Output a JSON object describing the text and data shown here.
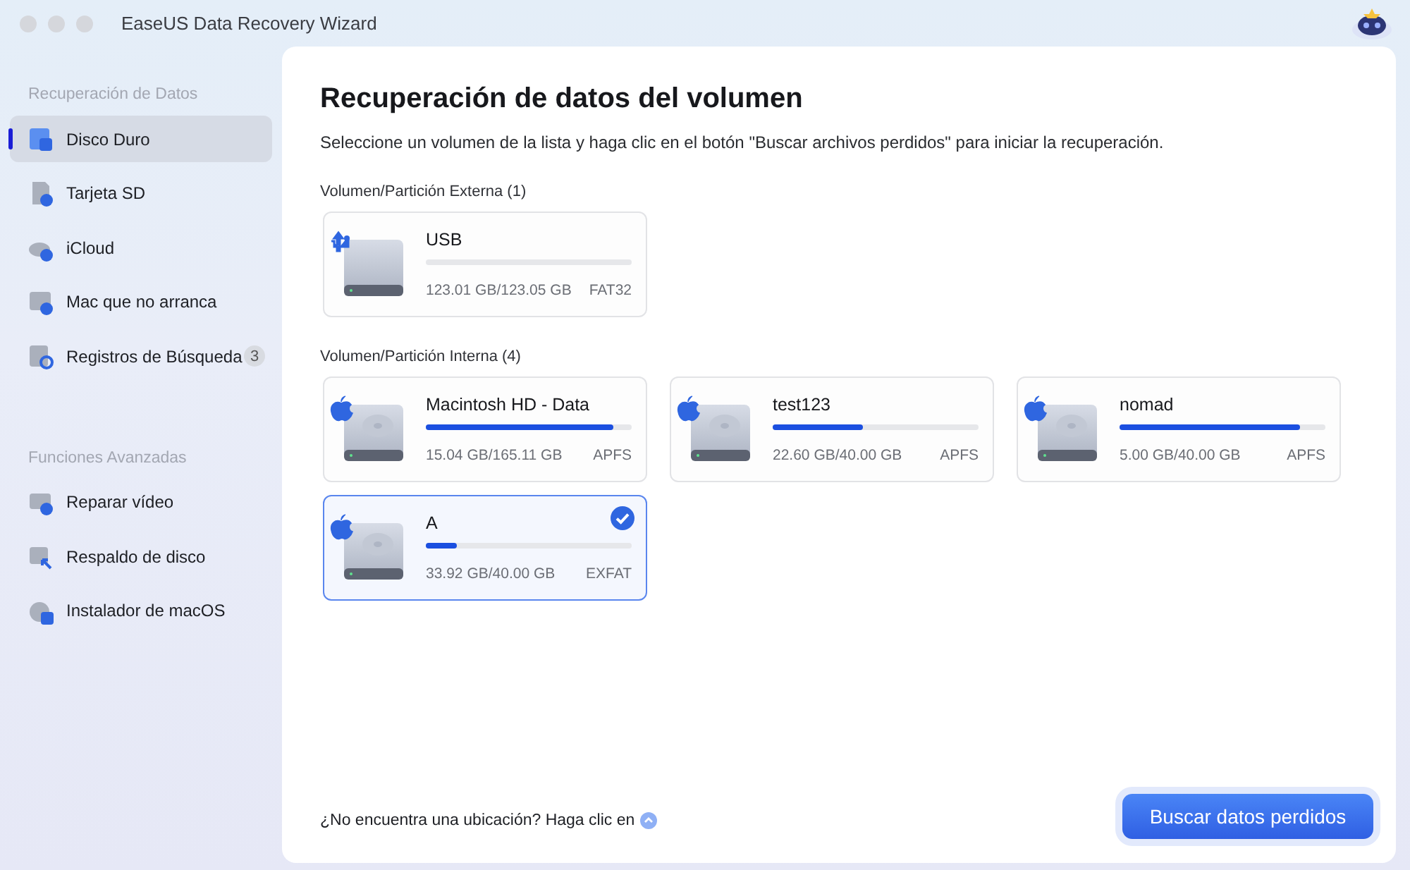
{
  "window": {
    "title": "EaseUS Data Recovery Wizard"
  },
  "sidebar": {
    "sections": [
      {
        "heading": "Recuperación de Datos",
        "items": [
          {
            "label": "Disco Duro",
            "kind": "disk",
            "selected": true
          },
          {
            "label": "Tarjeta SD",
            "kind": "sd",
            "selected": false
          },
          {
            "label": "iCloud",
            "kind": "cloud",
            "selected": false
          },
          {
            "label": "Mac que no arranca",
            "kind": "alert",
            "selected": false
          },
          {
            "label": "Registros de Búsqueda",
            "kind": "log",
            "selected": false,
            "badge": "3"
          }
        ]
      },
      {
        "heading": "Funciones Avanzadas",
        "items": [
          {
            "label": "Reparar vídeo",
            "kind": "video",
            "selected": false
          },
          {
            "label": "Respaldo de disco",
            "kind": "backup",
            "selected": false
          },
          {
            "label": "Instalador de macOS",
            "kind": "installer",
            "selected": false
          }
        ]
      }
    ]
  },
  "main": {
    "title": "Recuperación de datos del volumen",
    "subtitle": "Seleccione un volumen de la lista y haga clic en el botón \"Buscar archivos perdidos\" para iniciar la recuperación.",
    "groups": [
      {
        "heading": "Volumen/Partición Externa (1)",
        "volumes": [
          {
            "name": "USB",
            "kind": "usb",
            "level": 0.0,
            "usage": "123.01 GB/123.05 GB",
            "format": "FAT32",
            "selected": false
          }
        ]
      },
      {
        "heading": "Volumen/Partición Interna (4)",
        "volumes": [
          {
            "name": "Macintosh HD - Data",
            "kind": "apple",
            "level": 0.91,
            "usage": "15.04 GB/165.11 GB",
            "format": "APFS",
            "selected": false
          },
          {
            "name": "test123",
            "kind": "apple",
            "level": 0.44,
            "usage": "22.60 GB/40.00 GB",
            "format": "APFS",
            "selected": false
          },
          {
            "name": "nomad",
            "kind": "apple",
            "level": 0.88,
            "usage": "5.00 GB/40.00 GB",
            "format": "APFS",
            "selected": false
          },
          {
            "name": "A",
            "kind": "apple",
            "level": 0.15,
            "usage": "33.92 GB/40.00 GB",
            "format": "EXFAT",
            "selected": true
          }
        ]
      }
    ]
  },
  "footer": {
    "hint": "¿No encuentra una ubicación? Haga clic en",
    "button": "Buscar datos perdidos"
  }
}
